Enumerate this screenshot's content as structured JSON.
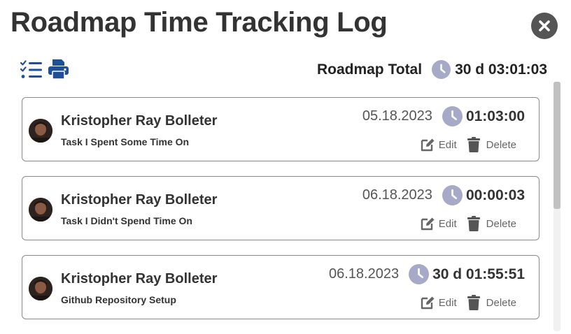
{
  "header": {
    "title": "Roadmap Time Tracking Log",
    "close_icon": "circle-x-icon"
  },
  "toolbar": {
    "list_icon": "checklist-icon",
    "print_icon": "printer-icon",
    "total_label": "Roadmap Total",
    "total_icon": "clock-icon",
    "total_value": "30 d 03:01:03"
  },
  "entries": [
    {
      "name": "Kristopher Ray Bolleter",
      "task": "Task I Spent Some Time On",
      "date": "05.18.2023",
      "duration": "01:03:00",
      "edit_label": "Edit",
      "delete_label": "Delete"
    },
    {
      "name": "Kristopher Ray Bolleter",
      "task": "Task I Didn't Spend Time On",
      "date": "06.18.2023",
      "duration": "00:00:03",
      "edit_label": "Edit",
      "delete_label": "Delete"
    },
    {
      "name": "Kristopher Ray Bolleter",
      "task": "Github Repository Setup",
      "date": "06.18.2023",
      "duration": "30 d 01:55:51",
      "edit_label": "Edit",
      "delete_label": "Delete"
    }
  ],
  "colors": {
    "accent_blue": "#1f4e9a",
    "clock_fill": "#a6aac6",
    "text_dark": "#333333",
    "close_button": "#555555"
  }
}
